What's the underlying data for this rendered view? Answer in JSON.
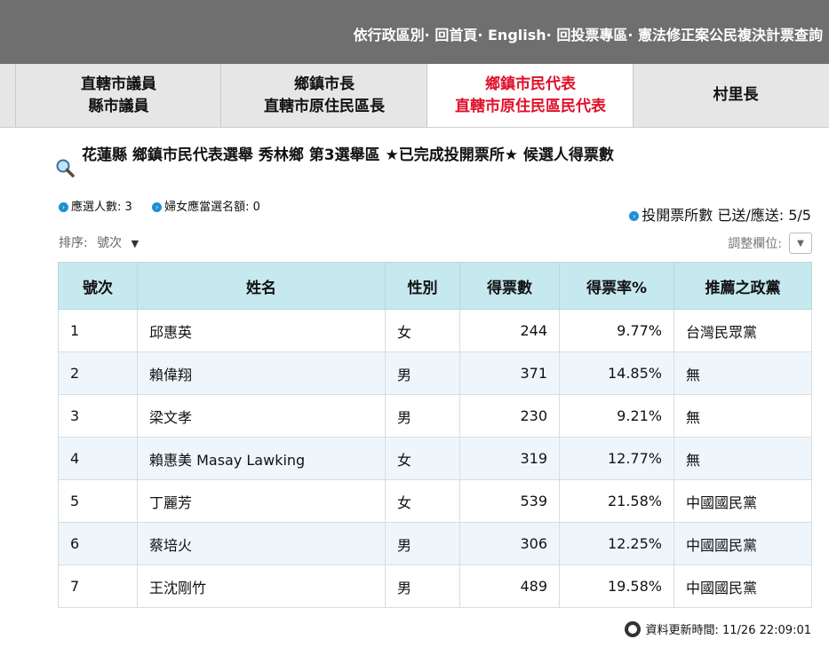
{
  "top_nav": {
    "links": [
      "依行政區別",
      "回首頁",
      "English",
      "回投票專區",
      "憲法修正案公民複決計票查詢"
    ],
    "separator": "· "
  },
  "tabs": [
    {
      "line1": "直轄市議員",
      "line2": "縣市議員",
      "active": false
    },
    {
      "line1": "鄉鎮市長",
      "line2": "直轄市原住民區長",
      "active": false
    },
    {
      "line1": "鄉鎮市民代表",
      "line2": "直轄市原住民區民代表",
      "active": true
    },
    {
      "line1": "村里長",
      "line2": "",
      "active": false
    }
  ],
  "page_title": "花蓮縣 鄉鎮市民代表選舉 秀林鄉 第3選舉區 ★已完成投開票所★ 候選人得票數",
  "stats": {
    "seats_label": "應選人數: 3",
    "women_label": "婦女應當選名額: 0",
    "stations_label": "投開票所數 已送/應送: 5/5"
  },
  "sort": {
    "label": "排序:",
    "value": "號次",
    "arrow": "▼"
  },
  "adjust": {
    "label": "調整欄位:",
    "arrow": "▼"
  },
  "table": {
    "headers": [
      "號次",
      "姓名",
      "性別",
      "得票數",
      "得票率%",
      "推薦之政黨"
    ],
    "rows": [
      [
        "1",
        "邱惠英",
        "女",
        "244",
        "9.77%",
        "台灣民眾黨"
      ],
      [
        "2",
        "賴偉翔",
        "男",
        "371",
        "14.85%",
        "無"
      ],
      [
        "3",
        "梁文孝",
        "男",
        "230",
        "9.21%",
        "無"
      ],
      [
        "4",
        "賴惠美 Masay Lawking",
        "女",
        "319",
        "12.77%",
        "無"
      ],
      [
        "5",
        "丁麗芳",
        "女",
        "539",
        "21.58%",
        "中國國民黨"
      ],
      [
        "6",
        "蔡培火",
        "男",
        "306",
        "12.25%",
        "中國國民黨"
      ],
      [
        "7",
        "王沈剛竹",
        "男",
        "489",
        "19.58%",
        "中國國民黨"
      ]
    ]
  },
  "footer": {
    "updated": "資料更新時間: 11/26 22:09:01"
  },
  "colors": {
    "top_bar": "#6f6f6f",
    "active_tab_text": "#e0102a",
    "header_bg": "#c6e8ef",
    "bullet": "#1d8fd6"
  }
}
